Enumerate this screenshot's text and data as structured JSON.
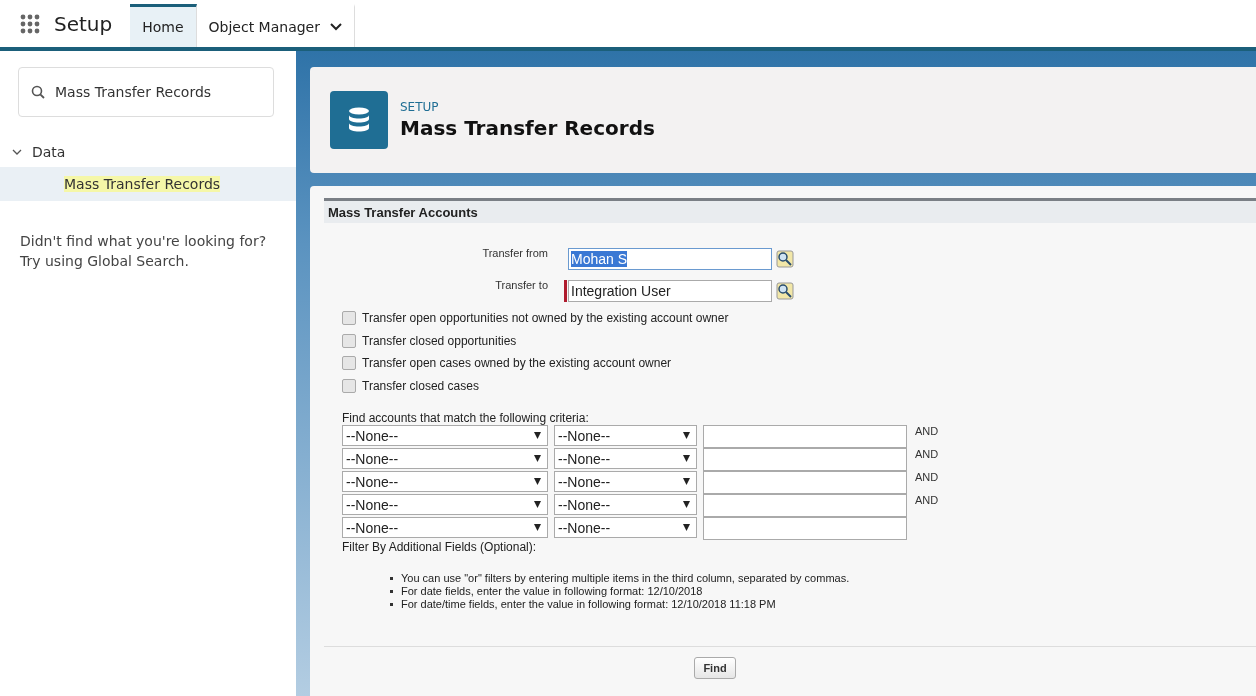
{
  "app_bar": {
    "app_name": "Setup",
    "tabs": [
      {
        "label": "Home",
        "selected": true,
        "has_menu": false
      },
      {
        "label": "Object Manager",
        "selected": false,
        "has_menu": true
      }
    ]
  },
  "sidebar": {
    "search": {
      "value": "Mass Transfer Records"
    },
    "tree": [
      {
        "label": "Data",
        "expanded": true,
        "selected": false,
        "children": [
          {
            "label": "Mass Transfer Records",
            "selected": true,
            "highlighted": true
          }
        ]
      }
    ],
    "help_lines": [
      "Didn't find what you're looking for?",
      "Try using Global Search."
    ]
  },
  "page_header": {
    "eyebrow": "SETUP",
    "title": "Mass Transfer Records"
  },
  "form": {
    "section_title": "Mass Transfer Accounts",
    "fields": [
      {
        "label": "Transfer from",
        "value": "Mohan S",
        "text_selected": true,
        "required": false
      },
      {
        "label": "Transfer to",
        "value": "Integration User",
        "text_selected": false,
        "required": true
      }
    ],
    "options": [
      {
        "label": "Transfer open opportunities not owned by the existing account owner",
        "checked": false
      },
      {
        "label": "Transfer closed opportunities",
        "checked": false
      },
      {
        "label": "Transfer open cases owned by the existing account owner",
        "checked": false
      },
      {
        "label": "Transfer closed cases",
        "checked": false
      }
    ],
    "criteria_title": "Find accounts that match the following criteria:",
    "criteria": [
      {
        "field": "--None--",
        "operator": "--None--",
        "connector": "AND"
      },
      {
        "field": "--None--",
        "operator": "--None--",
        "connector": "AND"
      },
      {
        "field": "--None--",
        "operator": "--None--",
        "connector": "AND"
      },
      {
        "field": "--None--",
        "operator": "--None--",
        "connector": "AND"
      },
      {
        "field": "--None--",
        "operator": "--None--"
      }
    ],
    "filter_note": "Filter By Additional Fields (Optional):",
    "tips": [
      "You can use \"or\" filters by entering multiple items in the third column, separated by commas.",
      "For date fields, enter the value in following format: 12/10/2018",
      "For date/time fields, enter the value in following format: 12/10/2018 11:18 PM"
    ],
    "button": "Find"
  }
}
